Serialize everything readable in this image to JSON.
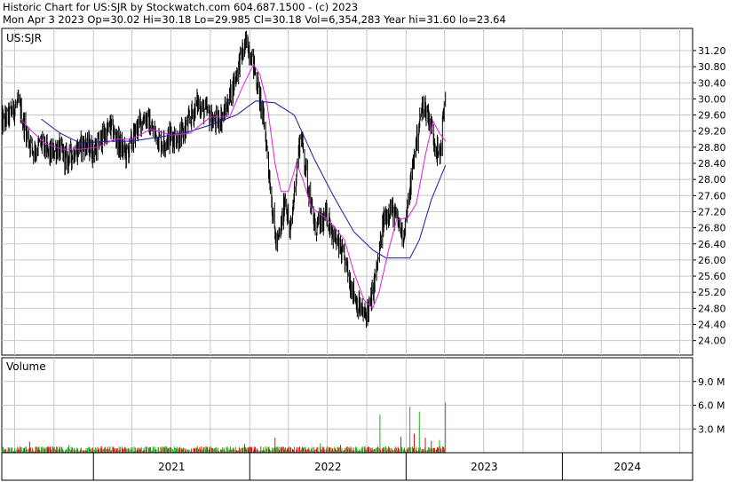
{
  "header": {
    "title": "Historic Chart for US:SJR by Stockwatch.com 604.687.1500 - (c) 2023",
    "date": "Mon Apr  3 2023",
    "open": "Op=30.02",
    "high": "Hi=30.18",
    "low": "Lo=29.985",
    "close": "Cl=30.18",
    "volume": "Vol=6,354,283",
    "year_high": "Year hi=31.60",
    "year_low": "lo=23.64"
  },
  "colors": {
    "price": "#000000",
    "ma_short": "#e020e0",
    "ma_long": "#1a1aa0",
    "vol_up": "#22aa22",
    "vol_down": "#dd1111",
    "grid": "#c8c8c8",
    "border": "#000000"
  },
  "chart_data": [
    {
      "type": "line",
      "panel": "price",
      "label": "US:SJR",
      "x_range": [
        "2020-06-01",
        "2024-10-31"
      ],
      "yticks": [
        "31.20",
        "30.80",
        "30.40",
        "30.00",
        "29.60",
        "29.20",
        "28.80",
        "28.40",
        "28.00",
        "27.60",
        "27.20",
        "26.80",
        "26.40",
        "26.00",
        "25.60",
        "25.20",
        "24.80",
        "24.40",
        "24.00"
      ],
      "ylim": [
        23.64,
        31.75
      ],
      "grid": true,
      "series": [
        {
          "role": "close",
          "points": [
            [
              "2020-06-01",
              29.4
            ],
            [
              "2020-06-20",
              29.6
            ],
            [
              "2020-07-10",
              29.9
            ],
            [
              "2020-07-30",
              29.1
            ],
            [
              "2020-08-15",
              28.7
            ],
            [
              "2020-09-01",
              28.9
            ],
            [
              "2020-09-20",
              28.6
            ],
            [
              "2020-10-10",
              28.8
            ],
            [
              "2020-10-30",
              28.5
            ],
            [
              "2020-11-20",
              28.7
            ],
            [
              "2020-12-10",
              28.9
            ],
            [
              "2021-01-01",
              28.7
            ],
            [
              "2021-01-20",
              29.0
            ],
            [
              "2021-02-10",
              29.3
            ],
            [
              "2021-03-01",
              28.9
            ],
            [
              "2021-03-20",
              28.6
            ],
            [
              "2021-04-10",
              29.2
            ],
            [
              "2021-05-01",
              29.6
            ],
            [
              "2021-05-20",
              29.2
            ],
            [
              "2021-06-10",
              28.9
            ],
            [
              "2021-07-01",
              29.1
            ],
            [
              "2021-07-20",
              29.0
            ],
            [
              "2021-08-10",
              29.4
            ],
            [
              "2021-09-01",
              29.9
            ],
            [
              "2021-09-20",
              29.7
            ],
            [
              "2021-10-10",
              29.4
            ],
            [
              "2021-11-01",
              29.6
            ],
            [
              "2021-11-20",
              30.2
            ],
            [
              "2021-12-10",
              31.0
            ],
            [
              "2021-12-25",
              31.4
            ],
            [
              "2022-01-05",
              31.1
            ],
            [
              "2022-01-20",
              30.3
            ],
            [
              "2022-02-05",
              29.3
            ],
            [
              "2022-02-15",
              28.2
            ],
            [
              "2022-02-25",
              27.0
            ],
            [
              "2022-03-05",
              26.3
            ],
            [
              "2022-03-15",
              26.8
            ],
            [
              "2022-03-25",
              27.6
            ],
            [
              "2022-04-05",
              26.6
            ],
            [
              "2022-04-20",
              28.2
            ],
            [
              "2022-04-30",
              29.2
            ],
            [
              "2022-05-15",
              28.0
            ],
            [
              "2022-06-01",
              26.8
            ],
            [
              "2022-06-15",
              26.9
            ],
            [
              "2022-07-01",
              27.1
            ],
            [
              "2022-07-20",
              26.5
            ],
            [
              "2022-08-10",
              26.0
            ],
            [
              "2022-08-25",
              25.4
            ],
            [
              "2022-09-10",
              24.9
            ],
            [
              "2022-09-25",
              24.6
            ],
            [
              "2022-10-10",
              24.9
            ],
            [
              "2022-10-25",
              25.8
            ],
            [
              "2022-11-10",
              27.0
            ],
            [
              "2022-11-25",
              27.3
            ],
            [
              "2022-12-10",
              27.0
            ],
            [
              "2022-12-25",
              26.6
            ],
            [
              "2023-01-05",
              27.3
            ],
            [
              "2023-01-20",
              28.6
            ],
            [
              "2023-02-01",
              29.4
            ],
            [
              "2023-02-10",
              29.9
            ],
            [
              "2023-02-25",
              29.5
            ],
            [
              "2023-03-10",
              28.9
            ],
            [
              "2023-03-20",
              28.5
            ],
            [
              "2023-04-03",
              30.18
            ]
          ]
        },
        {
          "role": "moving-average-short",
          "points": [
            [
              "2020-07-15",
              29.5
            ],
            [
              "2020-08-10",
              29.2
            ],
            [
              "2020-09-10",
              28.9
            ],
            [
              "2020-10-20",
              28.75
            ],
            [
              "2020-12-01",
              28.75
            ],
            [
              "2021-01-10",
              28.8
            ],
            [
              "2021-02-20",
              29.0
            ],
            [
              "2021-04-01",
              29.0
            ],
            [
              "2021-05-15",
              29.25
            ],
            [
              "2021-07-01",
              29.1
            ],
            [
              "2021-08-15",
              29.15
            ],
            [
              "2021-10-01",
              29.55
            ],
            [
              "2021-11-15",
              29.55
            ],
            [
              "2021-12-15",
              30.3
            ],
            [
              "2022-01-10",
              30.85
            ],
            [
              "2022-01-25",
              30.6
            ],
            [
              "2022-02-10",
              29.9
            ],
            [
              "2022-03-01",
              28.4
            ],
            [
              "2022-03-15",
              27.7
            ],
            [
              "2022-04-01",
              27.7
            ],
            [
              "2022-04-20",
              28.4
            ],
            [
              "2022-05-05",
              28.0
            ],
            [
              "2022-05-25",
              27.3
            ],
            [
              "2022-06-20",
              27.1
            ],
            [
              "2022-07-15",
              26.85
            ],
            [
              "2022-08-10",
              26.5
            ],
            [
              "2022-09-01",
              25.7
            ],
            [
              "2022-09-25",
              25.0
            ],
            [
              "2022-10-15",
              24.8
            ],
            [
              "2022-10-30",
              25.2
            ],
            [
              "2022-11-20",
              26.2
            ],
            [
              "2022-12-10",
              27.0
            ],
            [
              "2023-01-05",
              27.05
            ],
            [
              "2023-01-25",
              27.4
            ],
            [
              "2023-02-15",
              28.6
            ],
            [
              "2023-03-05",
              29.45
            ],
            [
              "2023-03-20",
              29.15
            ],
            [
              "2023-04-03",
              28.95
            ]
          ]
        },
        {
          "role": "moving-average-long",
          "points": [
            [
              "2020-09-01",
              29.5
            ],
            [
              "2020-10-15",
              29.15
            ],
            [
              "2020-12-01",
              28.9
            ],
            [
              "2021-02-01",
              28.95
            ],
            [
              "2021-04-01",
              28.95
            ],
            [
              "2021-06-01",
              29.05
            ],
            [
              "2021-08-01",
              29.15
            ],
            [
              "2021-10-01",
              29.35
            ],
            [
              "2021-12-01",
              29.6
            ],
            [
              "2022-01-15",
              29.95
            ],
            [
              "2022-03-01",
              29.9
            ],
            [
              "2022-04-15",
              29.6
            ],
            [
              "2022-06-01",
              28.5
            ],
            [
              "2022-07-15",
              27.6
            ],
            [
              "2022-09-01",
              26.7
            ],
            [
              "2022-10-15",
              26.25
            ],
            [
              "2022-11-15",
              26.05
            ],
            [
              "2022-12-15",
              26.05
            ],
            [
              "2023-01-10",
              26.05
            ],
            [
              "2023-02-01",
              26.5
            ],
            [
              "2023-03-01",
              27.5
            ],
            [
              "2023-04-03",
              28.35
            ]
          ]
        }
      ]
    },
    {
      "type": "bar",
      "panel": "volume",
      "label": "Volume",
      "yticks": [
        "9.0 M",
        "6.0 M",
        "3.0 M"
      ],
      "ylim": [
        0,
        12000000
      ],
      "x_tick_labels": [
        "2021",
        "2022",
        "2023",
        "2024"
      ],
      "x_ticks": [
        "2021-01-01",
        "2022-01-01",
        "2023-01-01",
        "2024-01-01"
      ],
      "spikes": [
        [
          "2020-06-20",
          0.9,
          "down"
        ],
        [
          "2020-07-05",
          2.6,
          "down"
        ],
        [
          "2020-08-05",
          1.4,
          "down"
        ],
        [
          "2020-09-20",
          0.9,
          "up"
        ],
        [
          "2020-11-05",
          1.0,
          "up"
        ],
        [
          "2021-01-20",
          0.8,
          "down"
        ],
        [
          "2021-03-05",
          0.7,
          "up"
        ],
        [
          "2021-06-10",
          0.6,
          "down"
        ],
        [
          "2021-09-01",
          0.8,
          "up"
        ],
        [
          "2021-12-20",
          1.1,
          "down"
        ],
        [
          "2022-01-15",
          1.5,
          "down"
        ],
        [
          "2022-02-20",
          3.2,
          "down"
        ],
        [
          "2022-03-01",
          1.9,
          "down"
        ],
        [
          "2022-05-01",
          1.6,
          "up"
        ],
        [
          "2022-06-15",
          1.2,
          "up"
        ],
        [
          "2022-08-01",
          1.0,
          "down"
        ],
        [
          "2022-10-01",
          1.3,
          "down"
        ],
        [
          "2022-11-01",
          4.8,
          "up"
        ],
        [
          "2022-12-20",
          2.0,
          "down"
        ],
        [
          "2023-01-01",
          10.5,
          "up"
        ],
        [
          "2023-01-10",
          5.8,
          "up"
        ],
        [
          "2023-01-20",
          2.4,
          "down"
        ],
        [
          "2023-02-01",
          5.2,
          "up"
        ],
        [
          "2023-02-05",
          6.0,
          "up"
        ],
        [
          "2023-02-15",
          1.9,
          "down"
        ],
        [
          "2023-03-01",
          1.5,
          "down"
        ],
        [
          "2023-03-20",
          1.6,
          "up"
        ],
        [
          "2023-04-03",
          6.35,
          "up"
        ]
      ],
      "baseline_range_m": [
        0.1,
        0.8
      ]
    }
  ]
}
